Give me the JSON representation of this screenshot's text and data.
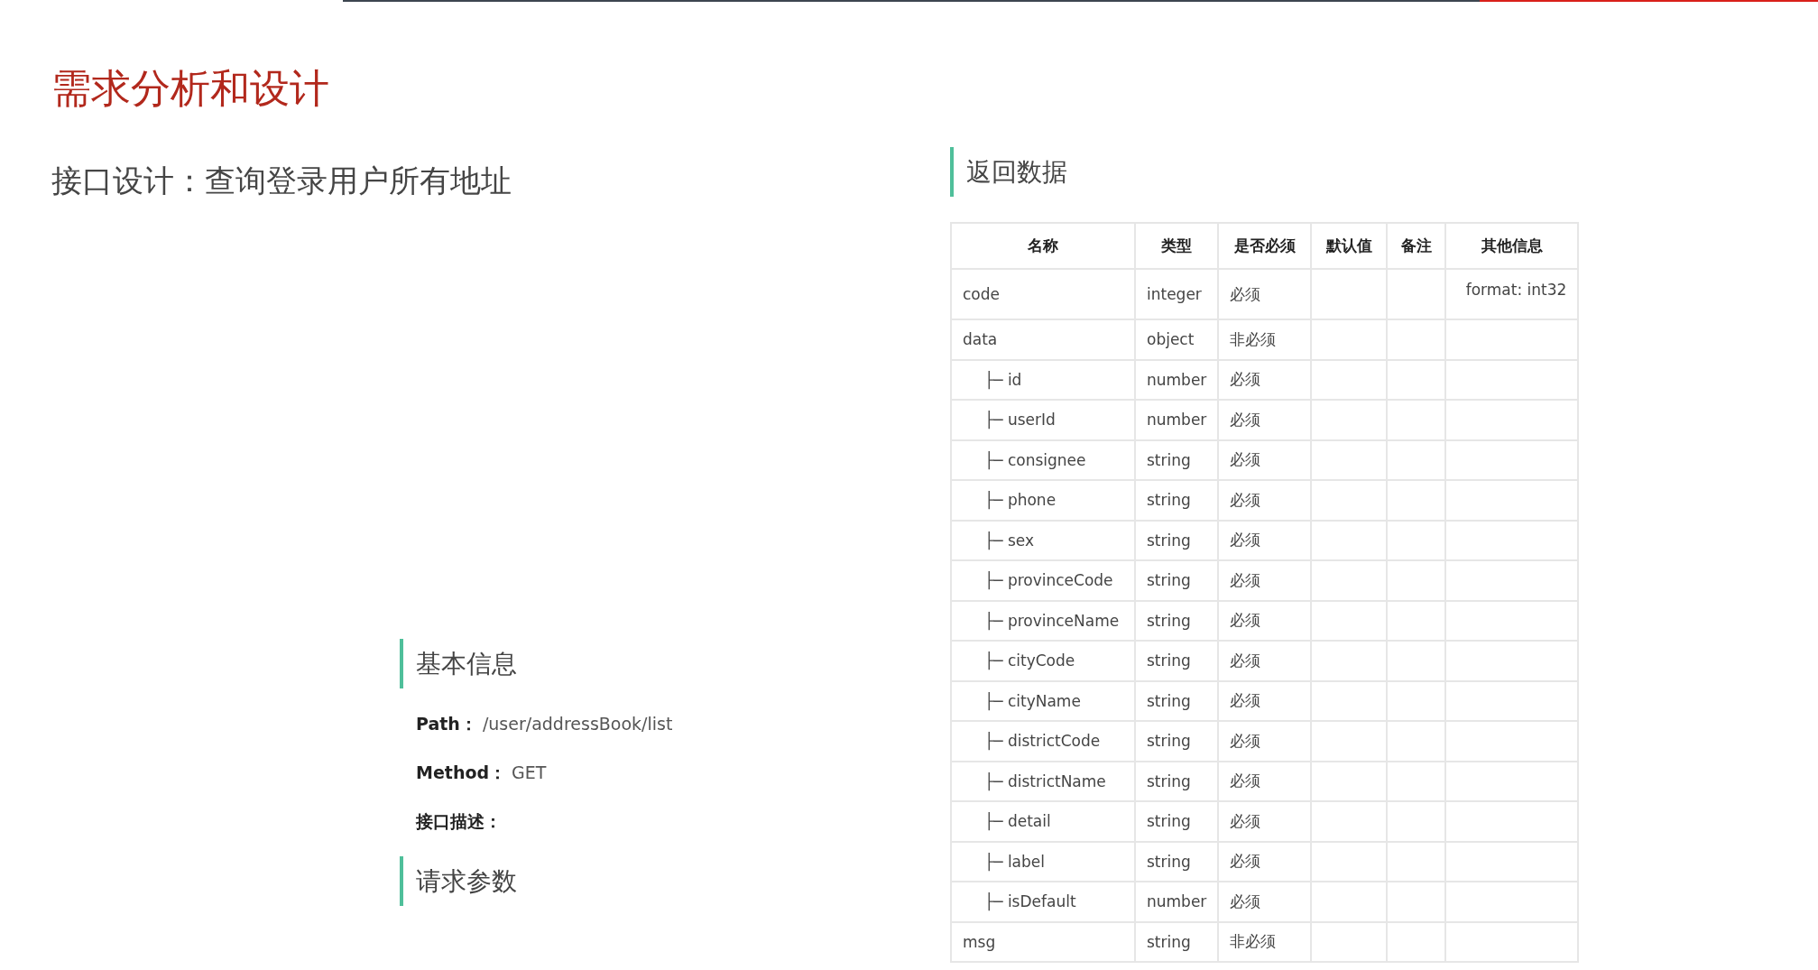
{
  "slide": {
    "title": "需求分析和设计",
    "subtitle": "接口设计：查询登录用户所有地址"
  },
  "basic_info": {
    "heading": "基本信息",
    "fields": [
      {
        "label": "Path：",
        "value": "/user/addressBook/list"
      },
      {
        "label": "Method：",
        "value": "GET"
      },
      {
        "label": "接口描述："
      }
    ]
  },
  "request_params": {
    "heading": "请求参数"
  },
  "response": {
    "heading": "返回数据",
    "table": {
      "columns": [
        "名称",
        "类型",
        "是否必须",
        "默认值",
        "备注",
        "其他信息"
      ],
      "rows": [
        {
          "name": "code",
          "type": "integer",
          "required": "必须",
          "other": "format: int32"
        },
        {
          "name": "data",
          "type": "object",
          "required": "非必须",
          "children": [
            {
              "prefix": "├─",
              "name": "id",
              "type": "number",
              "required": "必须"
            },
            {
              "prefix": "├─",
              "name": "userId",
              "type": "number",
              "required": "必须"
            },
            {
              "prefix": "├─",
              "name": "consignee",
              "type": "string",
              "required": "必须"
            },
            {
              "prefix": "├─",
              "name": "phone",
              "type": "string",
              "required": "必须"
            },
            {
              "prefix": "├─",
              "name": "sex",
              "type": "string",
              "required": "必须"
            },
            {
              "prefix": "├─",
              "name": "provinceCode",
              "type": "string",
              "required": "必须"
            },
            {
              "prefix": "├─",
              "name": "provinceName",
              "type": "string",
              "required": "必须"
            },
            {
              "prefix": "├─",
              "name": "cityCode",
              "type": "string",
              "required": "必须"
            },
            {
              "prefix": "├─",
              "name": "cityName",
              "type": "string",
              "required": "必须"
            },
            {
              "prefix": "├─",
              "name": "districtCode",
              "type": "string",
              "required": "必须"
            },
            {
              "prefix": "├─",
              "name": "districtName",
              "type": "string",
              "required": "必须"
            },
            {
              "prefix": "├─",
              "name": "detail",
              "type": "string",
              "required": "必须"
            },
            {
              "prefix": "├─",
              "name": "label",
              "type": "string",
              "required": "必须"
            },
            {
              "prefix": "├─",
              "name": "isDefault",
              "type": "number",
              "required": "必须"
            }
          ]
        },
        {
          "name": "msg",
          "type": "string",
          "required": "非必须"
        }
      ]
    }
  }
}
